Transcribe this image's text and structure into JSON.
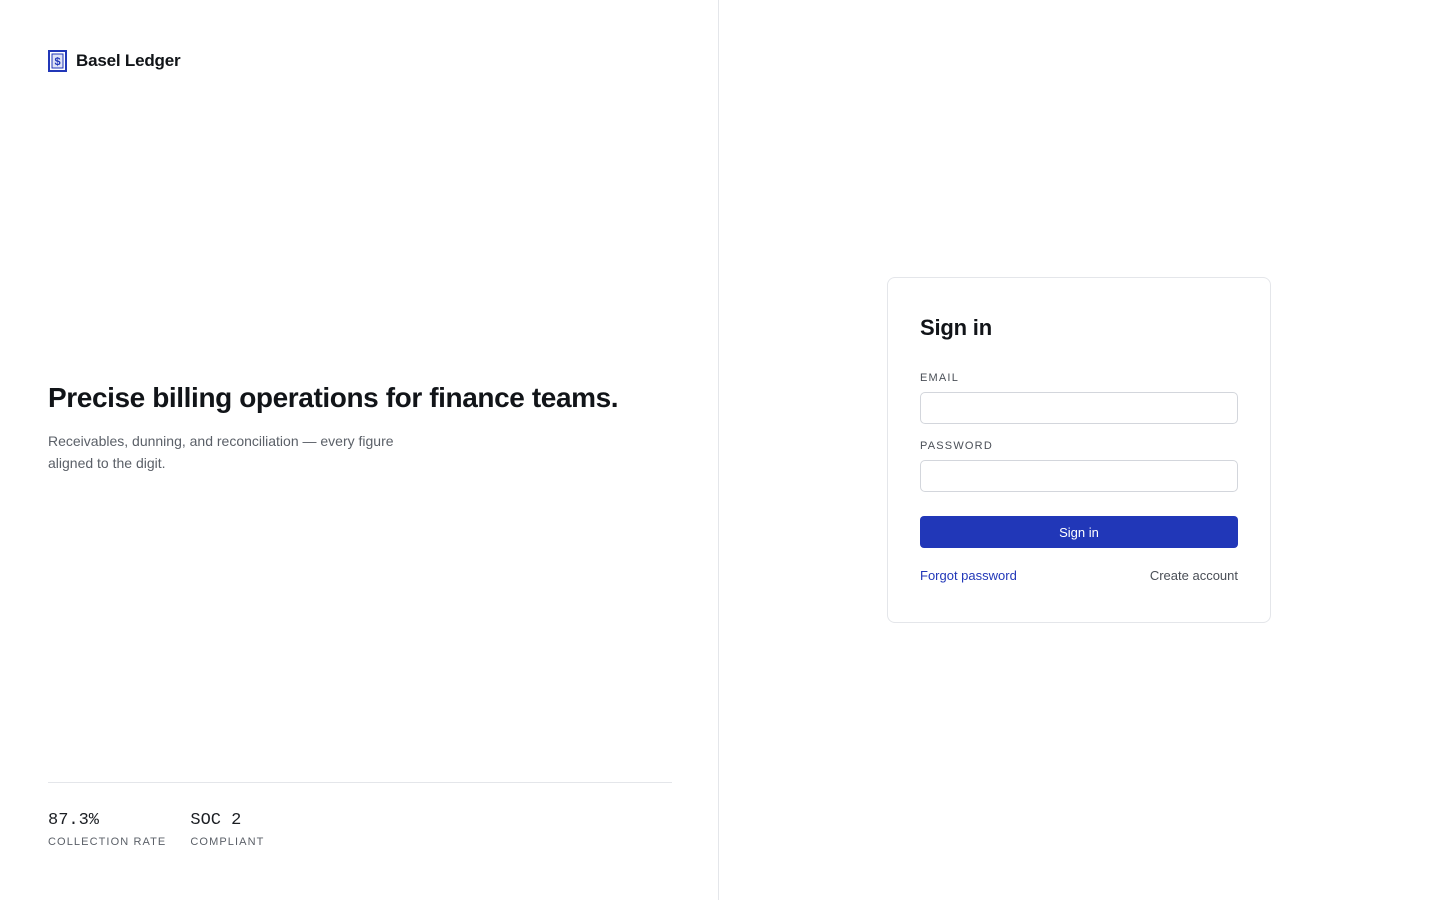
{
  "brand": {
    "name": "Basel Ledger",
    "logo_icon": "receipt-dollar-icon",
    "accent_color": "#2137b8"
  },
  "hero": {
    "headline": "Precise billing operations for finance teams.",
    "subhead": "Receivables, dunning, and reconciliation — every figure aligned to the digit."
  },
  "stats": [
    {
      "value": "87.3%",
      "label": "COLLECTION RATE"
    },
    {
      "value": "SOC 2",
      "label": "COMPLIANT"
    }
  ],
  "signin": {
    "title": "Sign in",
    "email_label": "EMAIL",
    "email_value": "",
    "password_label": "PASSWORD",
    "password_value": "",
    "submit_label": "Sign in",
    "forgot_label": "Forgot password",
    "create_label": "Create account"
  }
}
